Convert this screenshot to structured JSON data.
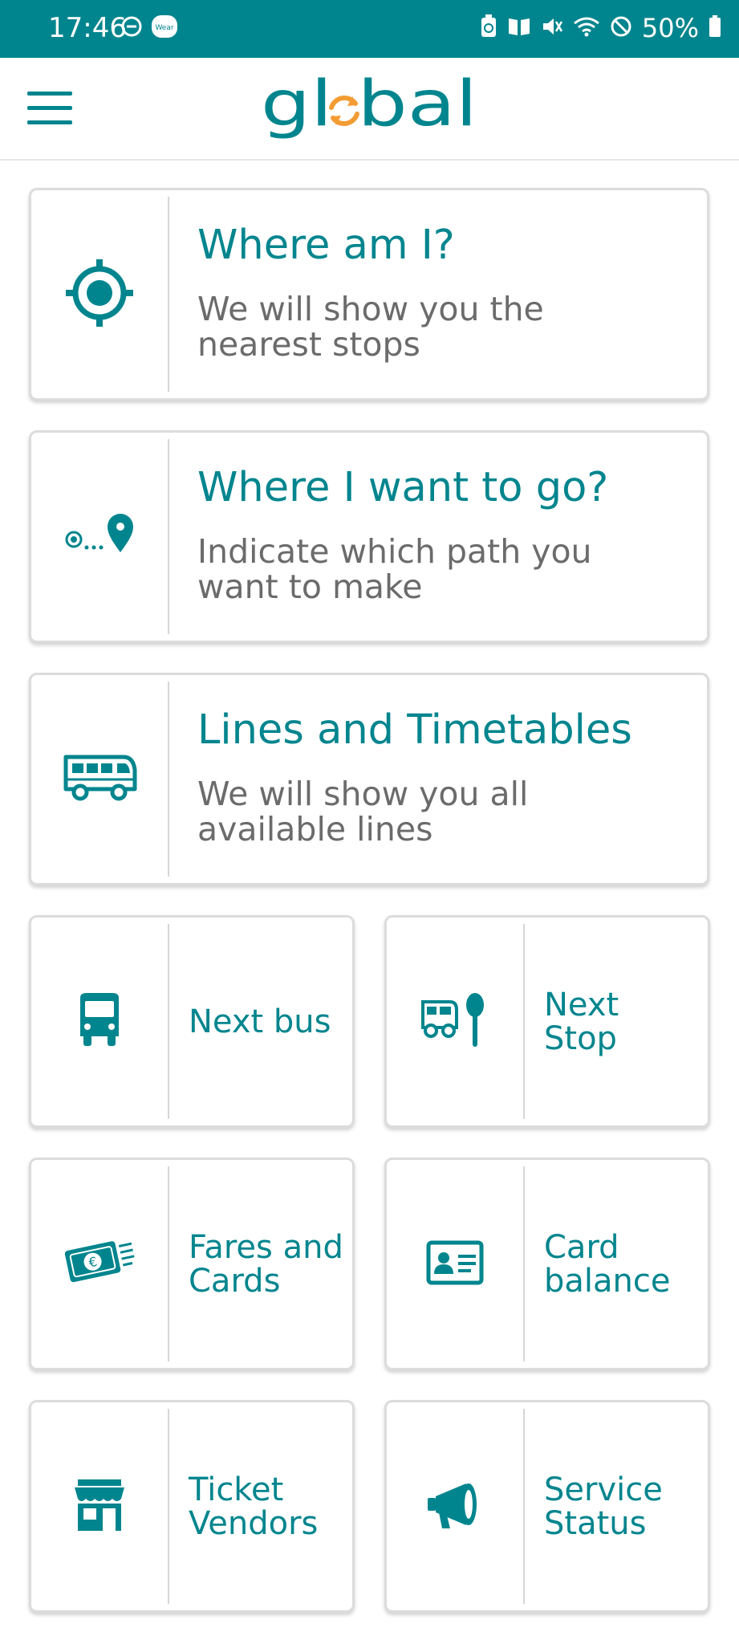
{
  "status_bar": {
    "time": "17:46",
    "battery_percent": "50%",
    "left_icons": [
      "do-not-disturb-icon",
      "wear-app-icon"
    ],
    "right_icons": [
      "battery-saver-icon",
      "reading-mode-icon",
      "mute-icon",
      "wifi-icon",
      "blocked-icon",
      "battery-icon"
    ]
  },
  "header": {
    "logo_text": "global",
    "menu_icon": "hamburger-menu-icon"
  },
  "colors": {
    "primary": "#00858e",
    "accent": "#f39c34",
    "description_text": "#6b6b6b",
    "card_border": "#dcdcdc"
  },
  "wide_cards": [
    {
      "title": "Where am I?",
      "description": "We will show you the nearest stops",
      "icon": "location-target-icon"
    },
    {
      "title": "Where I want to go?",
      "description": "Indicate which path you want to make",
      "icon": "route-pin-icon"
    },
    {
      "title": "Lines and Timetables",
      "description": "We will show you all available lines",
      "icon": "coach-bus-icon"
    }
  ],
  "small_cards": [
    {
      "label": "Next bus",
      "icon": "bus-front-icon"
    },
    {
      "label": "Next Stop",
      "icon": "bus-stop-icon"
    },
    {
      "label": "Fares and\nCards",
      "icon": "euro-banknote-icon"
    },
    {
      "label": "Card\nbalance",
      "icon": "id-card-icon"
    },
    {
      "label": "Ticket\nVendors",
      "icon": "shop-icon"
    },
    {
      "label": "Service\nStatus",
      "icon": "megaphone-icon"
    }
  ]
}
